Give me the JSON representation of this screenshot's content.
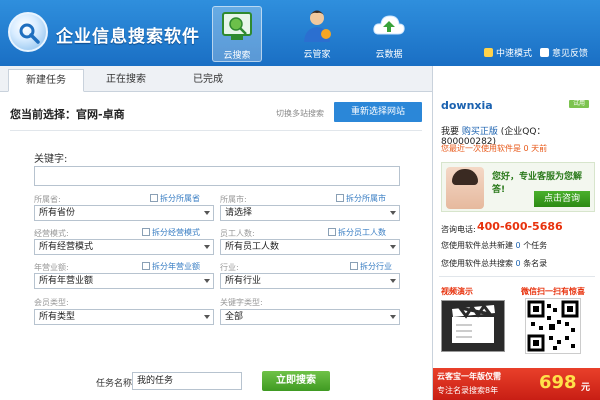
{
  "app": {
    "title": "企业信息搜索软件"
  },
  "top_nav": [
    {
      "label": "云搜索",
      "active": true
    },
    {
      "label": "云管家",
      "active": false
    },
    {
      "label": "云数据",
      "active": false
    }
  ],
  "header_links": {
    "accel": "中速模式",
    "feedback": "意见反馈"
  },
  "tabs": [
    {
      "label": "新建任务",
      "active": true
    },
    {
      "label": "正在搜索",
      "active": false
    },
    {
      "label": "已完成",
      "active": false
    }
  ],
  "main": {
    "current_selection": "您当前选择：官网-卓商",
    "switch_hint": "切换多站搜索",
    "reselect_button": "重新选择网站",
    "keyword_label": "关键字:",
    "keyword_value": "",
    "fields": {
      "province": {
        "label": "所属省:",
        "split": "拆分所属省",
        "value": "所有省份"
      },
      "city": {
        "label": "所属市:",
        "split": "拆分所属市",
        "value": "请选择"
      },
      "mode": {
        "label": "经营模式:",
        "split": "拆分经营模式",
        "value": "所有经营模式"
      },
      "staff": {
        "label": "员工人数:",
        "split": "拆分员工人数",
        "value": "所有员工人数"
      },
      "revenue": {
        "label": "年营业额:",
        "split": "拆分年营业额",
        "value": "所有年营业额"
      },
      "industry": {
        "label": "行业:",
        "split": "拆分行业",
        "value": "所有行业"
      },
      "member": {
        "label": "会员类型:",
        "split": "",
        "value": "所有类型"
      },
      "keyword_type": {
        "label": "关键字类型:",
        "split": "",
        "value": "全部"
      }
    },
    "task_label": "任务名称",
    "task_value": "我的任务",
    "search_button": "立即搜索"
  },
  "sidebar": {
    "username": "downxia",
    "badge": "试用",
    "account_prefix": "我要",
    "account_link": "购买正版",
    "account_qq": "(企业QQ：800000282)",
    "last_used": "您最近一次使用软件是 0 天前",
    "support_text": "您好，专业客服为您解答!",
    "consult_button": "点击咨询",
    "hotline_label": "咨询电话:",
    "hotline": "400-600-5686",
    "stat_tasks_prefix": "您使用软件总共新建",
    "stat_tasks_value": "0",
    "stat_tasks_suffix": "个任务",
    "stat_records_prefix": "您使用软件总共搜索",
    "stat_records_value": "0",
    "stat_records_suffix": "条名录",
    "video_label": "视频演示",
    "wechat_label": "微信扫一扫有惊喜",
    "banner_line1": "云客宝一年版仅需",
    "banner_line2": "专注名录搜索8年",
    "banner_price": "698",
    "banner_unit": "元"
  }
}
